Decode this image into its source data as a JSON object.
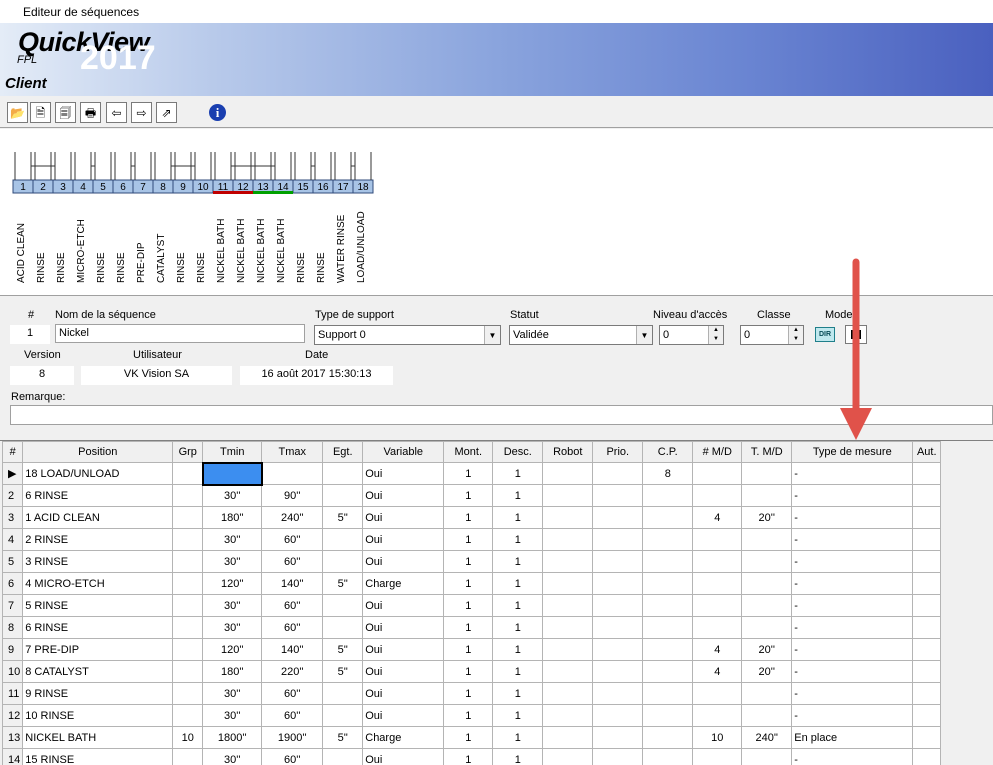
{
  "window": {
    "title": "Editeur de séquences"
  },
  "banner": {
    "brand": "QuickView",
    "sub": "FPL",
    "year": "2017",
    "client": "Client"
  },
  "toolbar": {
    "buttons": [
      {
        "name": "open-icon",
        "glyph": "📂"
      },
      {
        "name": "new-doc-icon",
        "glyph": "🗎"
      },
      {
        "name": "delete-doc-icon",
        "glyph": "🗐"
      },
      {
        "name": "print-icon",
        "glyph": "🖶"
      },
      {
        "name": "import-icon",
        "glyph": "⇦"
      },
      {
        "name": "export-icon",
        "glyph": "⇨"
      },
      {
        "name": "export-folder-icon",
        "glyph": "⇗"
      }
    ],
    "info_glyph": "i"
  },
  "tanks": {
    "numbers": [
      "1",
      "2",
      "3",
      "4",
      "5",
      "6",
      "7",
      "8",
      "9",
      "10",
      "11",
      "12",
      "13",
      "14",
      "15",
      "16",
      "17",
      "18"
    ],
    "labels": [
      "ACID CLEAN",
      "RINSE",
      "RINSE",
      "MICRO-ETCH",
      "RINSE",
      "RINSE",
      "PRE-DIP",
      "CATALYST",
      "RINSE",
      "RINSE",
      "NICKEL BATH",
      "NICKEL BATH",
      "NICKEL BATH",
      "NICKEL BATH",
      "RINSE",
      "RINSE",
      "WATER RINSE",
      "LOAD/UNLOAD"
    ],
    "colors": {
      "base": "#a8c4e6",
      "red": "#c00000",
      "green": "#00a000"
    }
  },
  "form": {
    "num_label": "#",
    "num_value": "1",
    "name_label": "Nom de la séquence",
    "name_value": "Nickel",
    "support_label": "Type de support",
    "support_value": "Support 0",
    "statut_label": "Statut",
    "statut_value": "Validée",
    "niveau_label": "Niveau d'accès",
    "niveau_value": "0",
    "classe_label": "Classe",
    "classe_value": "0",
    "mode_label": "Mode",
    "dir_label": "DIR",
    "version_label": "Version",
    "version_value": "8",
    "user_label": "Utilisateur",
    "user_value": "VK Vision SA",
    "date_label": "Date",
    "date_value": "16 août 2017 15:30:13",
    "remarque_label": "Remarque:",
    "remarque_value": ""
  },
  "grid": {
    "headers": [
      "#",
      "Position",
      "Grp",
      "Tmin",
      "Tmax",
      "Egt.",
      "Variable",
      "Mont.",
      "Desc.",
      "Robot",
      "Prio.",
      "C.P.",
      "# M/D",
      "T. M/D",
      "Type de mesure",
      "Aut."
    ],
    "rows": [
      [
        "▶",
        "18 LOAD/UNLOAD",
        "",
        "",
        "",
        "",
        "Oui",
        "1",
        "1",
        "",
        "",
        "8",
        "",
        "",
        "-",
        ""
      ],
      [
        "2",
        "6 RINSE",
        "",
        "30''",
        "90''",
        "",
        "Oui",
        "1",
        "1",
        "",
        "",
        "",
        "",
        "",
        "-",
        ""
      ],
      [
        "3",
        "1 ACID CLEAN",
        "",
        "180''",
        "240''",
        "5''",
        "Oui",
        "1",
        "1",
        "",
        "",
        "",
        "4",
        "20''",
        "-",
        ""
      ],
      [
        "4",
        "2 RINSE",
        "",
        "30''",
        "60''",
        "",
        "Oui",
        "1",
        "1",
        "",
        "",
        "",
        "",
        "",
        "-",
        ""
      ],
      [
        "5",
        "3 RINSE",
        "",
        "30''",
        "60''",
        "",
        "Oui",
        "1",
        "1",
        "",
        "",
        "",
        "",
        "",
        "-",
        ""
      ],
      [
        "6",
        "4 MICRO-ETCH",
        "",
        "120''",
        "140''",
        "5''",
        "Charge",
        "1",
        "1",
        "",
        "",
        "",
        "",
        "",
        "-",
        ""
      ],
      [
        "7",
        "5 RINSE",
        "",
        "30''",
        "60''",
        "",
        "Oui",
        "1",
        "1",
        "",
        "",
        "",
        "",
        "",
        "-",
        ""
      ],
      [
        "8",
        "6 RINSE",
        "",
        "30''",
        "60''",
        "",
        "Oui",
        "1",
        "1",
        "",
        "",
        "",
        "",
        "",
        "-",
        ""
      ],
      [
        "9",
        "7 PRE-DIP",
        "",
        "120''",
        "140''",
        "5''",
        "Oui",
        "1",
        "1",
        "",
        "",
        "",
        "4",
        "20''",
        "-",
        ""
      ],
      [
        "10",
        "8 CATALYST",
        "",
        "180''",
        "220''",
        "5''",
        "Oui",
        "1",
        "1",
        "",
        "",
        "",
        "4",
        "20''",
        "-",
        ""
      ],
      [
        "11",
        "9 RINSE",
        "",
        "30''",
        "60''",
        "",
        "Oui",
        "1",
        "1",
        "",
        "",
        "",
        "",
        "",
        "-",
        ""
      ],
      [
        "12",
        "10 RINSE",
        "",
        "30''",
        "60''",
        "",
        "Oui",
        "1",
        "1",
        "",
        "",
        "",
        "",
        "",
        "-",
        ""
      ],
      [
        "13",
        "NICKEL BATH",
        "10",
        "1800''",
        "1900''",
        "5''",
        "Charge",
        "1",
        "1",
        "",
        "",
        "",
        "10",
        "240''",
        "En place",
        ""
      ],
      [
        "14",
        "15 RINSE",
        "",
        "30''",
        "60''",
        "",
        "Oui",
        "1",
        "1",
        "",
        "",
        "",
        "",
        "",
        "-",
        ""
      ]
    ]
  },
  "annotation": {
    "color": "#e0524a"
  }
}
